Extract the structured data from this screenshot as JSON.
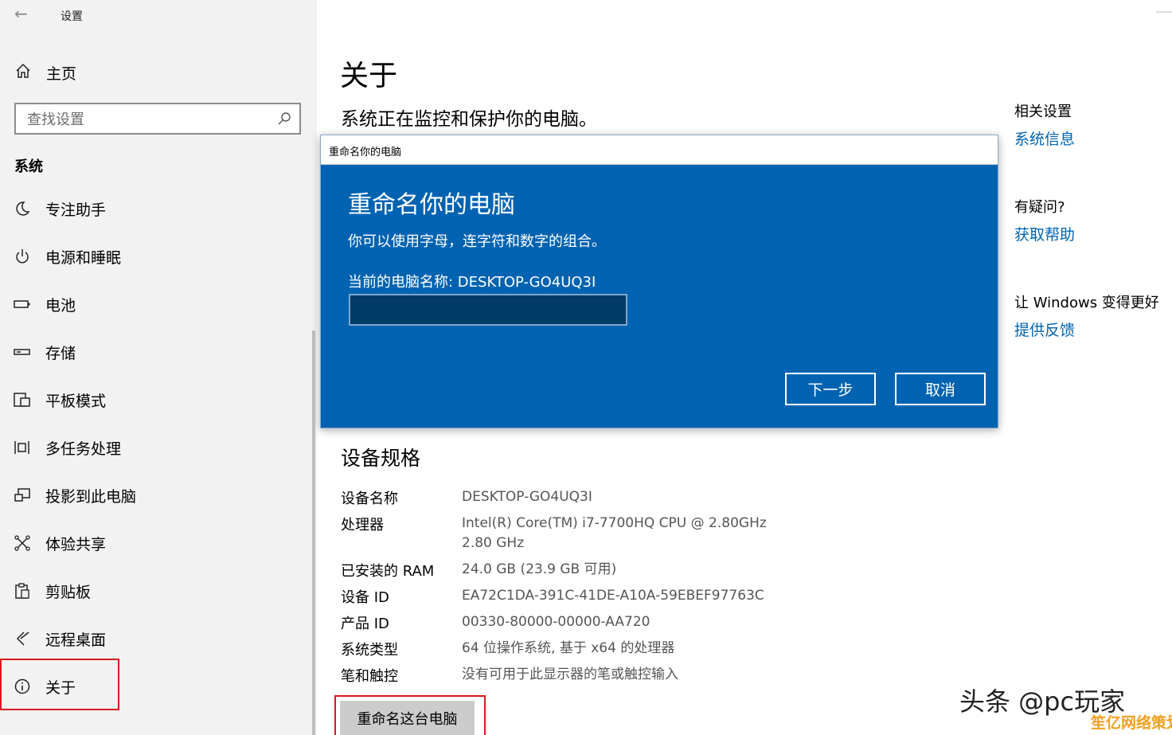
{
  "window": {
    "title": "设置"
  },
  "sidebar": {
    "home_label": "主页",
    "search_placeholder": "查找设置",
    "section": "系统",
    "items": [
      {
        "label": "专注助手",
        "icon": "moon-icon"
      },
      {
        "label": "电源和睡眠",
        "icon": "power-icon"
      },
      {
        "label": "电池",
        "icon": "battery-icon"
      },
      {
        "label": "存储",
        "icon": "storage-icon"
      },
      {
        "label": "平板模式",
        "icon": "tablet-mode-icon"
      },
      {
        "label": "多任务处理",
        "icon": "multitasking-icon"
      },
      {
        "label": "投影到此电脑",
        "icon": "projecting-icon"
      },
      {
        "label": "体验共享",
        "icon": "shared-experiences-icon"
      },
      {
        "label": "剪贴板",
        "icon": "clipboard-icon"
      },
      {
        "label": "远程桌面",
        "icon": "remote-desktop-icon"
      },
      {
        "label": "关于",
        "icon": "info-icon",
        "active": true
      }
    ]
  },
  "main": {
    "title": "关于",
    "status": "系统正在监控和保护你的电脑。",
    "specs_title": "设备规格",
    "specs": [
      {
        "label": "设备名称",
        "value": "DESKTOP-GO4UQ3I",
        "value2": ""
      },
      {
        "label": "处理器",
        "value": "Intel(R) Core(TM) i7-7700HQ CPU @ 2.80GHz",
        "value2": "2.80 GHz"
      },
      {
        "label": "已安装的 RAM",
        "value": "24.0 GB (23.9 GB 可用)",
        "value2": ""
      },
      {
        "label": "设备 ID",
        "value": "EA72C1DA-391C-41DE-A10A-59EBEF97763C",
        "value2": ""
      },
      {
        "label": "产品 ID",
        "value": "00330-80000-00000-AA720",
        "value2": ""
      },
      {
        "label": "系统类型",
        "value": "64 位操作系统, 基于 x64 的处理器",
        "value2": ""
      },
      {
        "label": "笔和触控",
        "value": "没有可用于此显示器的笔或触控输入",
        "value2": ""
      }
    ],
    "rename_button": "重命名这台电脑"
  },
  "related": {
    "heading": "相关设置",
    "link": "系统信息",
    "question_heading": "有疑问?",
    "help_link": "获取帮助",
    "improve_heading": "让 Windows 变得更好",
    "feedback_link": "提供反馈"
  },
  "dialog": {
    "window_title": "重命名你的电脑",
    "heading": "重命名你的电脑",
    "description": "你可以使用字母，连字符和数字的组合。",
    "current_name": "当前的电脑名称: DESKTOP-GO4UQ3I",
    "input_value": "",
    "next_button": "下一步",
    "cancel_button": "取消"
  },
  "watermark": {
    "line1": "头条 @pc玩家",
    "line2": "笙亿网络策划"
  },
  "colors": {
    "accent": "#0063b1",
    "highlight": "#d9181e",
    "sidebar_bg": "#f2f2f2"
  }
}
